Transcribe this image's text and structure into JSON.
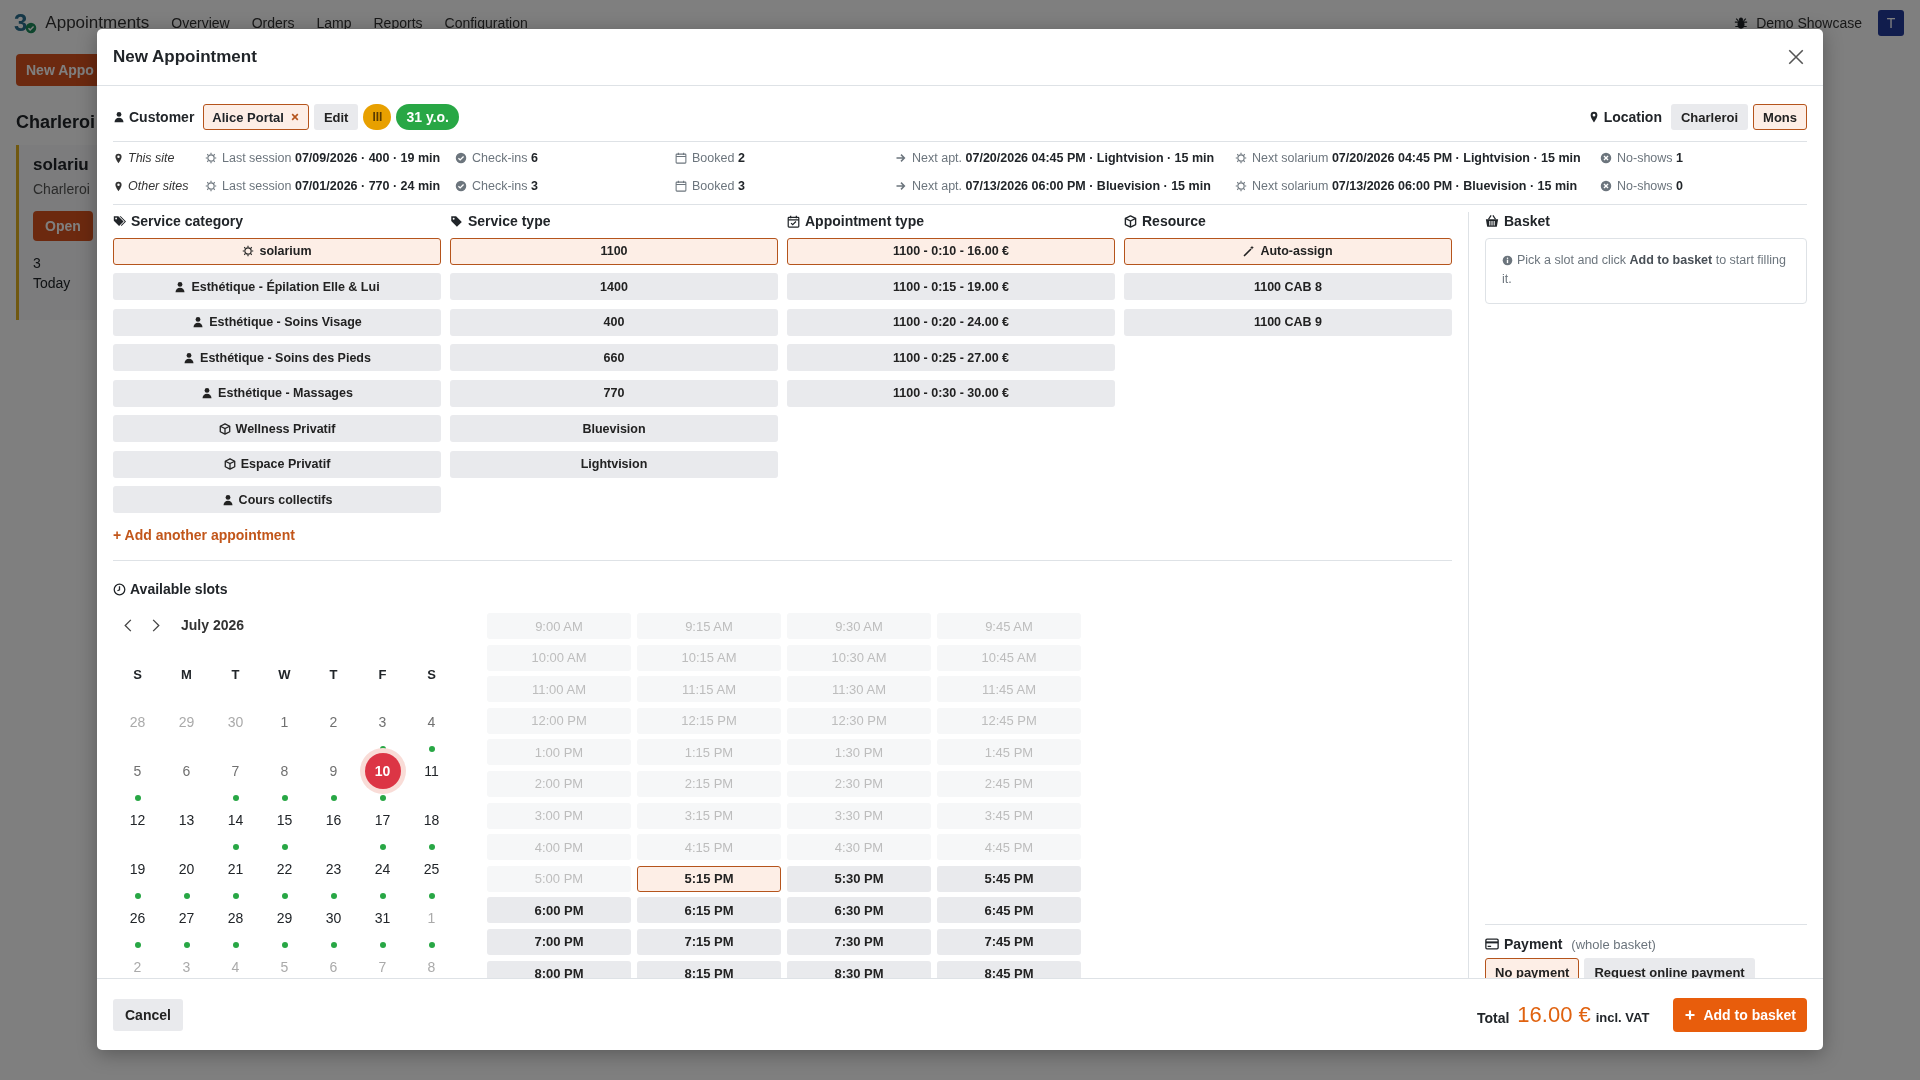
{
  "app_bar": {
    "logo_text": "3",
    "app_name": "Appointments",
    "nav": [
      "Overview",
      "Orders",
      "Lamp",
      "Reports",
      "Configuration"
    ],
    "company": "Demo Showcase",
    "avatar": "T"
  },
  "page": {
    "new_button": "New Appo",
    "heading": "Charleroi",
    "card": {
      "title": "solariu",
      "subtitle": "Charleroi",
      "open_button": "Open",
      "count": "3",
      "count_label": "Today"
    }
  },
  "dialog": {
    "title": "New Appointment",
    "customer": {
      "label": "Customer",
      "name": "Alice Portal",
      "edit": "Edit",
      "badge": "III",
      "age": "31 y.o."
    },
    "location": {
      "label": "Location",
      "options": [
        {
          "label": "Charleroi",
          "selected": false
        },
        {
          "label": "Mons",
          "selected": true
        }
      ]
    },
    "stats": [
      {
        "site": "This site",
        "items": [
          {
            "kind": "session",
            "label": "Last session",
            "value": "07/09/2026 · 400 · 19 min"
          },
          {
            "kind": "checkins",
            "label": "Check-ins",
            "value": "6"
          },
          {
            "kind": "booked",
            "label": "Booked",
            "value": "2"
          },
          {
            "kind": "next",
            "label": "Next apt.",
            "value": "07/20/2026 04:45 PM · Lightvision · 15 min"
          },
          {
            "kind": "session",
            "label": "Next solarium",
            "value": "07/20/2026 04:45 PM · Lightvision · 15 min"
          },
          {
            "kind": "noshows",
            "label": "No-shows",
            "value": "1"
          }
        ]
      },
      {
        "site": "Other sites",
        "items": [
          {
            "kind": "session",
            "label": "Last session",
            "value": "07/01/2026 · 770 · 24 min"
          },
          {
            "kind": "checkins",
            "label": "Check-ins",
            "value": "3"
          },
          {
            "kind": "booked",
            "label": "Booked",
            "value": "3"
          },
          {
            "kind": "next",
            "label": "Next apt.",
            "value": "07/13/2026 06:00 PM · Bluevision · 15 min"
          },
          {
            "kind": "session",
            "label": "Next solarium",
            "value": "07/13/2026 06:00 PM · Bluevision · 15 min"
          },
          {
            "kind": "noshows",
            "label": "No-shows",
            "value": "0"
          }
        ]
      }
    ],
    "selectors": [
      {
        "kind": "tags",
        "title": "Service category",
        "options": [
          {
            "kind": "sun",
            "label": "solarium",
            "selected": true
          },
          {
            "kind": "person",
            "label": "Esthétique - Épilation Elle & Lui",
            "selected": false
          },
          {
            "kind": "person",
            "label": "Esthétique - Soins Visage",
            "selected": false
          },
          {
            "kind": "person",
            "label": "Esthétique - Soins des Pieds",
            "selected": false
          },
          {
            "kind": "person",
            "label": "Esthétique - Massages",
            "selected": false
          },
          {
            "kind": "cube",
            "label": "Wellness Privatif",
            "selected": false
          },
          {
            "kind": "cube",
            "label": "Espace Privatif",
            "selected": false
          },
          {
            "kind": "person",
            "label": "Cours collectifs",
            "selected": false
          }
        ]
      },
      {
        "kind": "tag",
        "title": "Service type",
        "options": [
          {
            "kind": "plain",
            "label": "1100",
            "selected": true
          },
          {
            "kind": "plain",
            "label": "1400",
            "selected": false
          },
          {
            "kind": "plain",
            "label": "400",
            "selected": false
          },
          {
            "kind": "plain",
            "label": "660",
            "selected": false
          },
          {
            "kind": "plain",
            "label": "770",
            "selected": false
          },
          {
            "kind": "plain",
            "label": "Bluevision",
            "selected": false
          },
          {
            "kind": "plain",
            "label": "Lightvision",
            "selected": false
          }
        ]
      },
      {
        "kind": "calendar_check",
        "title": "Appointment type",
        "options": [
          {
            "kind": "plain",
            "label": "1100 - 0:10 - 16.00 €",
            "selected": true
          },
          {
            "kind": "plain",
            "label": "1100 - 0:15 - 19.00 €",
            "selected": false
          },
          {
            "kind": "plain",
            "label": "1100 - 0:20 - 24.00 €",
            "selected": false
          },
          {
            "kind": "plain",
            "label": "1100 - 0:25 - 27.00 €",
            "selected": false
          },
          {
            "kind": "plain",
            "label": "1100 - 0:30 - 30.00 €",
            "selected": false
          }
        ]
      },
      {
        "kind": "cube",
        "title": "Resource",
        "options": [
          {
            "kind": "wand",
            "label": "Auto-assign",
            "selected": true
          },
          {
            "kind": "plain",
            "label": "1100 CAB 8",
            "selected": false
          },
          {
            "kind": "plain",
            "label": "1100 CAB 9",
            "selected": false
          }
        ]
      }
    ],
    "add_link": "+ Add another appointment",
    "slots": {
      "title": "Available slots",
      "month": "July 2026",
      "weekdays": [
        "S",
        "M",
        "T",
        "W",
        "T",
        "F",
        "S"
      ],
      "weeks": [
        [
          {
            "day": "28",
            "outside": true,
            "past": false,
            "available": false,
            "selected": false
          },
          {
            "day": "29",
            "outside": true,
            "past": false,
            "available": false,
            "selected": false
          },
          {
            "day": "30",
            "outside": true,
            "past": false,
            "available": false,
            "selected": false
          },
          {
            "day": "1",
            "outside": false,
            "past": true,
            "available": false,
            "selected": false
          },
          {
            "day": "2",
            "outside": false,
            "past": true,
            "available": false,
            "selected": false
          },
          {
            "day": "3",
            "outside": false,
            "past": true,
            "available": true,
            "selected": false
          },
          {
            "day": "4",
            "outside": false,
            "past": true,
            "available": true,
            "selected": false
          }
        ],
        [
          {
            "day": "5",
            "outside": false,
            "past": true,
            "available": true,
            "selected": false
          },
          {
            "day": "6",
            "outside": false,
            "past": true,
            "available": false,
            "selected": false
          },
          {
            "day": "7",
            "outside": false,
            "past": true,
            "available": true,
            "selected": false
          },
          {
            "day": "8",
            "outside": false,
            "past": true,
            "available": true,
            "selected": false
          },
          {
            "day": "9",
            "outside": false,
            "past": true,
            "available": true,
            "selected": false
          },
          {
            "day": "10",
            "outside": false,
            "past": false,
            "available": true,
            "selected": true
          },
          {
            "day": "11",
            "outside": false,
            "past": false,
            "available": false,
            "selected": false
          }
        ],
        [
          {
            "day": "12",
            "outside": false,
            "past": false,
            "available": false,
            "selected": false
          },
          {
            "day": "13",
            "outside": false,
            "past": false,
            "available": false,
            "selected": false
          },
          {
            "day": "14",
            "outside": false,
            "past": false,
            "available": true,
            "selected": false
          },
          {
            "day": "15",
            "outside": false,
            "past": false,
            "available": true,
            "selected": false
          },
          {
            "day": "16",
            "outside": false,
            "past": false,
            "available": false,
            "selected": false
          },
          {
            "day": "17",
            "outside": false,
            "past": false,
            "available": true,
            "selected": false
          },
          {
            "day": "18",
            "outside": false,
            "past": false,
            "available": true,
            "selected": false
          }
        ],
        [
          {
            "day": "19",
            "outside": false,
            "past": false,
            "available": true,
            "selected": false
          },
          {
            "day": "20",
            "outside": false,
            "past": false,
            "available": true,
            "selected": false
          },
          {
            "day": "21",
            "outside": false,
            "past": false,
            "available": true,
            "selected": false
          },
          {
            "day": "22",
            "outside": false,
            "past": false,
            "available": true,
            "selected": false
          },
          {
            "day": "23",
            "outside": false,
            "past": false,
            "available": true,
            "selected": false
          },
          {
            "day": "24",
            "outside": false,
            "past": false,
            "available": true,
            "selected": false
          },
          {
            "day": "25",
            "outside": false,
            "past": false,
            "available": true,
            "selected": false
          }
        ],
        [
          {
            "day": "26",
            "outside": false,
            "past": false,
            "available": true,
            "selected": false
          },
          {
            "day": "27",
            "outside": false,
            "past": false,
            "available": true,
            "selected": false
          },
          {
            "day": "28",
            "outside": false,
            "past": false,
            "available": true,
            "selected": false
          },
          {
            "day": "29",
            "outside": false,
            "past": false,
            "available": true,
            "selected": false
          },
          {
            "day": "30",
            "outside": false,
            "past": false,
            "available": true,
            "selected": false
          },
          {
            "day": "31",
            "outside": false,
            "past": false,
            "available": true,
            "selected": false
          },
          {
            "day": "1",
            "outside": true,
            "past": false,
            "available": true,
            "selected": false
          }
        ],
        [
          {
            "day": "2",
            "outside": true,
            "past": false,
            "available": false,
            "selected": false
          },
          {
            "day": "3",
            "outside": true,
            "past": false,
            "available": false,
            "selected": false
          },
          {
            "day": "4",
            "outside": true,
            "past": false,
            "available": false,
            "selected": false
          },
          {
            "day": "5",
            "outside": true,
            "past": false,
            "available": false,
            "selected": false
          },
          {
            "day": "6",
            "outside": true,
            "past": false,
            "available": false,
            "selected": false
          },
          {
            "day": "7",
            "outside": true,
            "past": false,
            "available": false,
            "selected": false
          },
          {
            "day": "8",
            "outside": true,
            "past": false,
            "available": false,
            "selected": false
          }
        ]
      ],
      "times": [
        {
          "label": "9:00 AM",
          "disabled": true,
          "selected": false
        },
        {
          "label": "9:15 AM",
          "disabled": true,
          "selected": false
        },
        {
          "label": "9:30 AM",
          "disabled": true,
          "selected": false
        },
        {
          "label": "9:45 AM",
          "disabled": true,
          "selected": false
        },
        {
          "label": "10:00 AM",
          "disabled": true,
          "selected": false
        },
        {
          "label": "10:15 AM",
          "disabled": true,
          "selected": false
        },
        {
          "label": "10:30 AM",
          "disabled": true,
          "selected": false
        },
        {
          "label": "10:45 AM",
          "disabled": true,
          "selected": false
        },
        {
          "label": "11:00 AM",
          "disabled": true,
          "selected": false
        },
        {
          "label": "11:15 AM",
          "disabled": true,
          "selected": false
        },
        {
          "label": "11:30 AM",
          "disabled": true,
          "selected": false
        },
        {
          "label": "11:45 AM",
          "disabled": true,
          "selected": false
        },
        {
          "label": "12:00 PM",
          "disabled": true,
          "selected": false
        },
        {
          "label": "12:15 PM",
          "disabled": true,
          "selected": false
        },
        {
          "label": "12:30 PM",
          "disabled": true,
          "selected": false
        },
        {
          "label": "12:45 PM",
          "disabled": true,
          "selected": false
        },
        {
          "label": "1:00 PM",
          "disabled": true,
          "selected": false
        },
        {
          "label": "1:15 PM",
          "disabled": true,
          "selected": false
        },
        {
          "label": "1:30 PM",
          "disabled": true,
          "selected": false
        },
        {
          "label": "1:45 PM",
          "disabled": true,
          "selected": false
        },
        {
          "label": "2:00 PM",
          "disabled": true,
          "selected": false
        },
        {
          "label": "2:15 PM",
          "disabled": true,
          "selected": false
        },
        {
          "label": "2:30 PM",
          "disabled": true,
          "selected": false
        },
        {
          "label": "2:45 PM",
          "disabled": true,
          "selected": false
        },
        {
          "label": "3:00 PM",
          "disabled": true,
          "selected": false
        },
        {
          "label": "3:15 PM",
          "disabled": true,
          "selected": false
        },
        {
          "label": "3:30 PM",
          "disabled": true,
          "selected": false
        },
        {
          "label": "3:45 PM",
          "disabled": true,
          "selected": false
        },
        {
          "label": "4:00 PM",
          "disabled": true,
          "selected": false
        },
        {
          "label": "4:15 PM",
          "disabled": true,
          "selected": false
        },
        {
          "label": "4:30 PM",
          "disabled": true,
          "selected": false
        },
        {
          "label": "4:45 PM",
          "disabled": true,
          "selected": false
        },
        {
          "label": "5:00 PM",
          "disabled": true,
          "selected": false
        },
        {
          "label": "5:15 PM",
          "disabled": false,
          "selected": true
        },
        {
          "label": "5:30 PM",
          "disabled": false,
          "selected": false
        },
        {
          "label": "5:45 PM",
          "disabled": false,
          "selected": false
        },
        {
          "label": "6:00 PM",
          "disabled": false,
          "selected": false
        },
        {
          "label": "6:15 PM",
          "disabled": false,
          "selected": false
        },
        {
          "label": "6:30 PM",
          "disabled": false,
          "selected": false
        },
        {
          "label": "6:45 PM",
          "disabled": false,
          "selected": false
        },
        {
          "label": "7:00 PM",
          "disabled": false,
          "selected": false
        },
        {
          "label": "7:15 PM",
          "disabled": false,
          "selected": false
        },
        {
          "label": "7:30 PM",
          "disabled": false,
          "selected": false
        },
        {
          "label": "7:45 PM",
          "disabled": false,
          "selected": false
        },
        {
          "label": "8:00 PM",
          "disabled": false,
          "selected": false
        },
        {
          "label": "8:15 PM",
          "disabled": false,
          "selected": false
        },
        {
          "label": "8:30 PM",
          "disabled": false,
          "selected": false
        },
        {
          "label": "8:45 PM",
          "disabled": false,
          "selected": false
        }
      ]
    },
    "basket": {
      "title": "Basket",
      "empty_text": "Pick a slot and click **Add to basket** to start filling it."
    },
    "payment": {
      "title": "Payment",
      "note": "(whole basket)",
      "options": [
        {
          "label": "No payment",
          "selected": true
        },
        {
          "label": "Request online payment",
          "selected": false
        }
      ]
    },
    "footer": {
      "cancel": "Cancel",
      "total_label": "Total",
      "total": "16.00 €",
      "vat": "incl. VAT",
      "add_button": "Add to basket"
    }
  }
}
